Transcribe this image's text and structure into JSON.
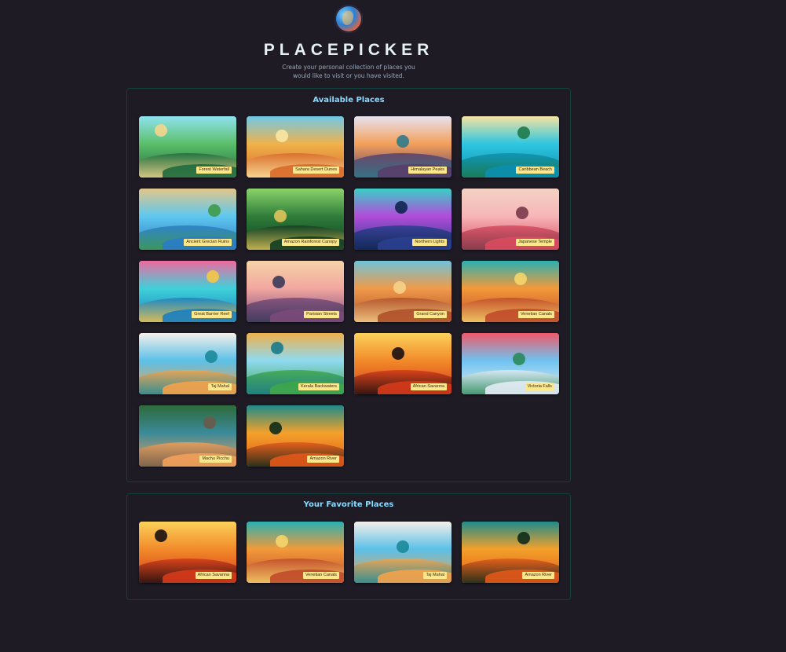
{
  "header": {
    "title": "PLACEPICKER",
    "subtitle": "Create your personal collection of places you would like to visit or you have visited.",
    "logo_icon": "globe-logo-icon"
  },
  "available": {
    "title": "Available Places",
    "places": [
      {
        "label": "Forest Waterfall",
        "colors": [
          "#5bbf6a",
          "#1f6b3d",
          "#8fe3f0",
          "#f4d58d"
        ]
      },
      {
        "label": "Sahara Desert Dunes",
        "colors": [
          "#f0b24c",
          "#d86a2a",
          "#6fc9e8",
          "#fbe6a2"
        ]
      },
      {
        "label": "Himalayan Peaks",
        "colors": [
          "#f3a05a",
          "#5a3d6b",
          "#e7e2f0",
          "#2f7a8a"
        ]
      },
      {
        "label": "Caribbean Beach",
        "colors": [
          "#2fc6e0",
          "#0b8fb0",
          "#f6e3a1",
          "#1d7a4a"
        ]
      },
      {
        "label": "Ancient Grecian Ruins",
        "colors": [
          "#5fc8ef",
          "#2a7cc6",
          "#e3c68a",
          "#3f9a4a"
        ]
      },
      {
        "label": "Amazon Rainforest Canopy",
        "colors": [
          "#2f7d3a",
          "#0f3d22",
          "#8bd46a",
          "#e0c45a"
        ]
      },
      {
        "label": "Northern Lights",
        "colors": [
          "#b14cd8",
          "#2a3f8f",
          "#3ad0c6",
          "#0f2550"
        ]
      },
      {
        "label": "Japanese Temple",
        "colors": [
          "#f6b6b8",
          "#d94a5f",
          "#f3d2c2",
          "#7a3a4a"
        ]
      },
      {
        "label": "Great Barrier Reef",
        "colors": [
          "#3fd1d9",
          "#1a7fc0",
          "#f06aa0",
          "#f5c648"
        ]
      },
      {
        "label": "Parisian Streets",
        "colors": [
          "#f2a7a0",
          "#7a4a7a",
          "#f6d3a8",
          "#3a3a5a"
        ]
      },
      {
        "label": "Grand Canyon",
        "colors": [
          "#f09a4a",
          "#b0502a",
          "#6fc3d9",
          "#f6d28a"
        ]
      },
      {
        "label": "Venetian Canals",
        "colors": [
          "#f39a3a",
          "#c04a2a",
          "#2ab0b0",
          "#f6d56a"
        ]
      },
      {
        "label": "Taj Mahal",
        "colors": [
          "#5bc0e8",
          "#f3a24a",
          "#f5f0ea",
          "#1a8a9a"
        ]
      },
      {
        "label": "Kerala Backwaters",
        "colors": [
          "#8fdaf2",
          "#3fa64a",
          "#f0b04a",
          "#1a7a8a"
        ]
      },
      {
        "label": "African Savanna",
        "colors": [
          "#f28a2a",
          "#d63a1a",
          "#fbd25a",
          "#1a0f0f"
        ]
      },
      {
        "label": "Victoria Falls",
        "colors": [
          "#6fc3f0",
          "#e3ecf5",
          "#f05a6a",
          "#2a8a5a"
        ]
      },
      {
        "label": "Machu Picchu",
        "colors": [
          "#3a8a9a",
          "#f3a05a",
          "#2f6a3a",
          "#6a5a4a"
        ]
      },
      {
        "label": "Amazon River",
        "colors": [
          "#f3a12a",
          "#e2581a",
          "#1f8a8a",
          "#0f2a1a"
        ]
      }
    ]
  },
  "favorites": {
    "title": "Your Favorite Places",
    "places": [
      {
        "label": "African Savanna",
        "colors": [
          "#f28a2a",
          "#d63a1a",
          "#fbd25a",
          "#1a0f0f"
        ]
      },
      {
        "label": "Venetian Canals",
        "colors": [
          "#f39a3a",
          "#c04a2a",
          "#2ab0b0",
          "#f6d56a"
        ]
      },
      {
        "label": "Taj Mahal",
        "colors": [
          "#5bc0e8",
          "#f3a24a",
          "#f5f0ea",
          "#1a8a9a"
        ]
      },
      {
        "label": "Amazon River",
        "colors": [
          "#f3a12a",
          "#e2581a",
          "#1f8a8a",
          "#0f2a1a"
        ]
      }
    ]
  }
}
